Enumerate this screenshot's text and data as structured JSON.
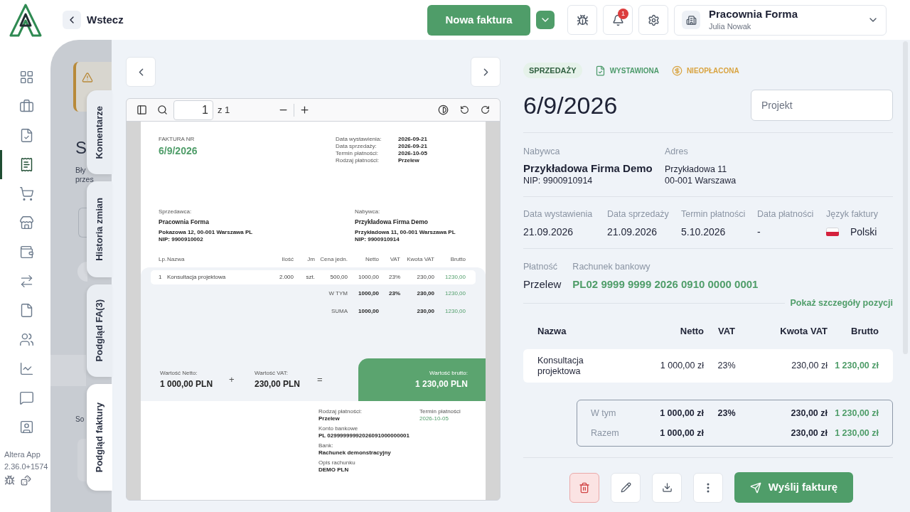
{
  "header": {
    "back": "Wstecz",
    "new_invoice": "Nowa faktura",
    "notification_count": "1",
    "company": "Pracownia Forma",
    "user": "Julia Nowak"
  },
  "nav": [
    {
      "selected": false
    },
    {
      "selected": false
    },
    {
      "selected": false
    },
    {
      "selected": true
    },
    {
      "selected": false
    },
    {
      "selected": false
    },
    {
      "selected": false
    },
    {
      "selected": false
    },
    {
      "selected": false
    },
    {
      "selected": false
    },
    {
      "selected": false
    },
    {
      "selected": false
    },
    {
      "selected": false
    }
  ],
  "app_version": {
    "name": "Altera App",
    "version": "2.36.0+1574"
  },
  "background": {
    "heading": "S",
    "text_lines": [
      "Bły",
      "przes"
    ],
    "label": "So"
  },
  "side_tabs": [
    {
      "label": "Komentarze",
      "selected": false
    },
    {
      "label": "Historia zmian",
      "selected": false
    },
    {
      "label": "Podgląd FA(3)",
      "selected": false
    },
    {
      "label": "Podgląd faktury",
      "selected": true
    }
  ],
  "pdf": {
    "page": "1",
    "page_count": "z 1",
    "doc_label": "FAKTURA NR",
    "doc_number": "6/9/2026",
    "meta": [
      {
        "label": "Data wystawienia:",
        "value": "2026-09-21"
      },
      {
        "label": "Data sprzedaży:",
        "value": "2026-09-21"
      },
      {
        "label": "Termin płatności:",
        "value": "2026-10-05"
      },
      {
        "label": "Rodzaj płatności:",
        "value": "Przelew"
      }
    ],
    "parties": [
      {
        "label": "Sprzedawca:",
        "name": "Pracownia Forma",
        "address": "Pokazowa 12, 00-001 Warszawa PL",
        "nip": "NIP: 9900910002"
      },
      {
        "label": "Nabywca:",
        "name": "Przykładowa Firma Demo",
        "address": "Przykładowa 11, 00-001 Warszawa PL",
        "nip": "NIP: 9900910914"
      }
    ],
    "columns": [
      "Lp.",
      "Nazwa",
      "Ilość",
      "Jm",
      "Cena jedn.",
      "Netto",
      "VAT",
      "Kwota VAT",
      "Brutto"
    ],
    "items": [
      [
        "1",
        "Konsultacja projektowa",
        "2.000",
        "szt.",
        "500,00",
        "1000,00",
        "23%",
        "230,00",
        "1230,00"
      ]
    ],
    "summary": [
      {
        "label": "W TYM",
        "netto": "1000,00",
        "vat": "23%",
        "vat_amount": "230,00",
        "brutto": "1230,00"
      },
      {
        "label": "SUMA",
        "netto": "1000,00",
        "vat_amount": "230,00",
        "brutto": "1230,00"
      }
    ],
    "totals": {
      "netto_label": "Wartość Netto:",
      "netto": "1 000,00 PLN",
      "plus": "+",
      "vat_label": "Wartość VAT:",
      "vat": "230,00 PLN",
      "equals": "=",
      "brutto_label": "Wartość brutto:",
      "brutto": "1 230,00 PLN"
    },
    "payment": [
      {
        "label": "Rodzaj płatności:",
        "value": "Przelew"
      },
      {
        "label": "Konto bankowe",
        "value": "PL 02999999992026091000000001"
      },
      {
        "label": "Bank:",
        "value": "Rachunek demonstracyjny"
      },
      {
        "label": "Opis rachunku",
        "value": "DEMO PLN"
      }
    ],
    "due": {
      "label": "Termin płatności",
      "value": "2026-10-05"
    }
  },
  "details": {
    "badges": [
      {
        "text": "SPRZEDAŻY",
        "kind": "pill",
        "color": "#2f5e3f"
      },
      {
        "text": "WYSTAWIONA",
        "kind": "document",
        "color": "#4c9a6a"
      },
      {
        "text": "NIEOPŁACONA",
        "kind": "coin",
        "color": "#d9a441"
      }
    ],
    "number": "6/9/2026",
    "project_placeholder": "Projekt",
    "buyer_label": "Nabywca",
    "buyer_name": "Przykładowa Firma Demo",
    "buyer_nip": "NIP: 9900910914",
    "address_label": "Adres",
    "address_lines": [
      "Przykładowa 11",
      "00-001 Warszawa"
    ],
    "dates": [
      {
        "label": "Data wystawienia",
        "value": "21.09.2026"
      },
      {
        "label": "Data sprzedaży",
        "value": "21.09.2026"
      },
      {
        "label": "Termin płatności",
        "value": "5.10.2026"
      },
      {
        "label": "Data płatności",
        "value": "-"
      }
    ],
    "language": {
      "label": "Język faktury",
      "value": "Polski"
    },
    "payment_label": "Płatność",
    "payment_value": "Przelew",
    "account_label": "Rachunek bankowy",
    "account": "PL02 9999 9999 2026 0910 0000 0001",
    "details_link": "Pokaż szczegóły pozycji",
    "columns": [
      "Nazwa",
      "Netto",
      "VAT",
      "Kwota VAT",
      "Brutto"
    ],
    "items": [
      {
        "name": "Konsultacja projektowa",
        "netto": "1 000,00 zł",
        "vat": "23%",
        "vat_amount": "230,00 zł",
        "brutto": "1 230,00 zł"
      }
    ],
    "summary": [
      {
        "label": "W tym",
        "netto": "1 000,00 zł",
        "vat": "23%",
        "vat_amount": "230,00 zł",
        "brutto": "1 230,00 zł"
      },
      {
        "label": "Razem",
        "netto": "1 000,00 zł",
        "vat_amount": "230,00 zł",
        "brutto": "1 230,00 zł"
      }
    ],
    "send_button": "Wyślij fakturę"
  }
}
